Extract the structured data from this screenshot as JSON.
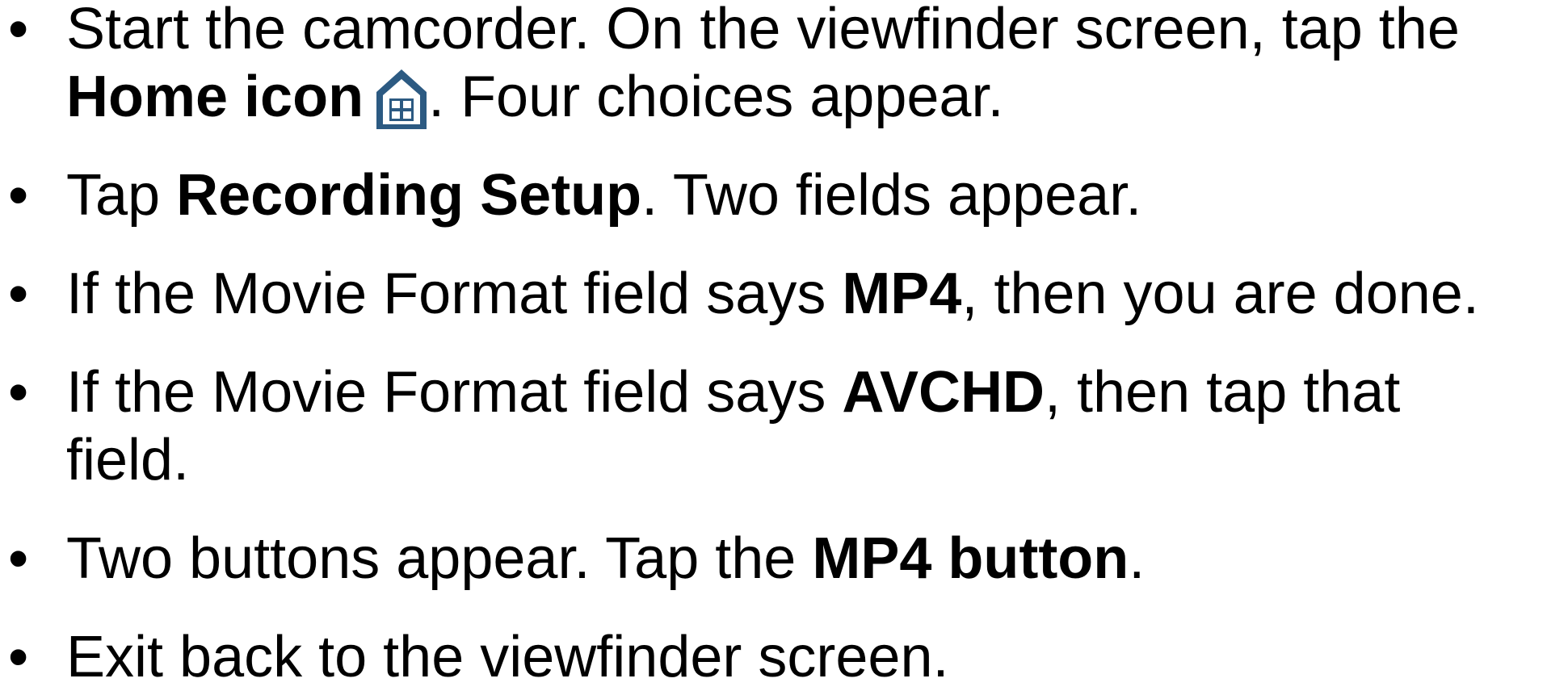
{
  "colors": {
    "text": "#000000",
    "icon": "#2c5a82"
  },
  "steps": [
    {
      "line1_a": "Start the camcorder. On the viewfinder screen, tap the",
      "bold": "Home icon",
      "icon": "home-icon",
      "rest": ". Four choices appear."
    },
    {
      "pre": "Tap ",
      "bold": "Recording Setup",
      "post": ". Two fields appear."
    },
    {
      "pre": "If the Movie Format field says ",
      "bold": "MP4",
      "post": ", then you are done."
    },
    {
      "pre": "If the Movie Format field says ",
      "bold": "AVCHD",
      "post": ", then tap that",
      "line2": "field."
    },
    {
      "pre": "Two buttons appear. Tap the ",
      "bold": "MP4 button",
      "post": "."
    },
    {
      "text": "Exit back to the viewfinder screen."
    }
  ]
}
